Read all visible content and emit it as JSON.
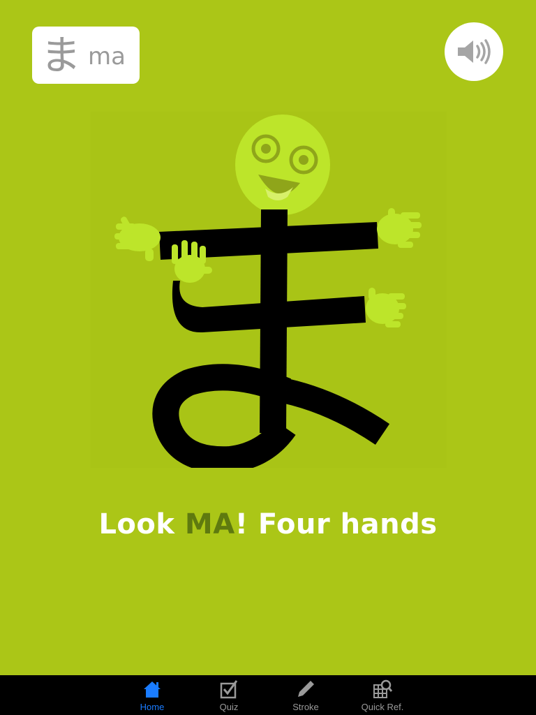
{
  "header": {
    "kana": "ま",
    "romaji": "ma"
  },
  "sound_button": {
    "icon": "speaker-icon"
  },
  "illustration": {
    "subject": "ま"
  },
  "caption": {
    "prefix": "Look ",
    "highlight": "MA",
    "suffix": "! Four hands"
  },
  "colors": {
    "background": "#abc617",
    "figure_face": "#bde52a",
    "highlight": "#5f7a0f",
    "tab_active": "#1a7cff"
  },
  "tabs": [
    {
      "label": "Home",
      "icon": "home-icon",
      "active": true
    },
    {
      "label": "Quiz",
      "icon": "checkbox-icon",
      "active": false
    },
    {
      "label": "Stroke",
      "icon": "pencil-icon",
      "active": false
    },
    {
      "label": "Quick Ref.",
      "icon": "grid-search-icon",
      "active": false
    }
  ]
}
